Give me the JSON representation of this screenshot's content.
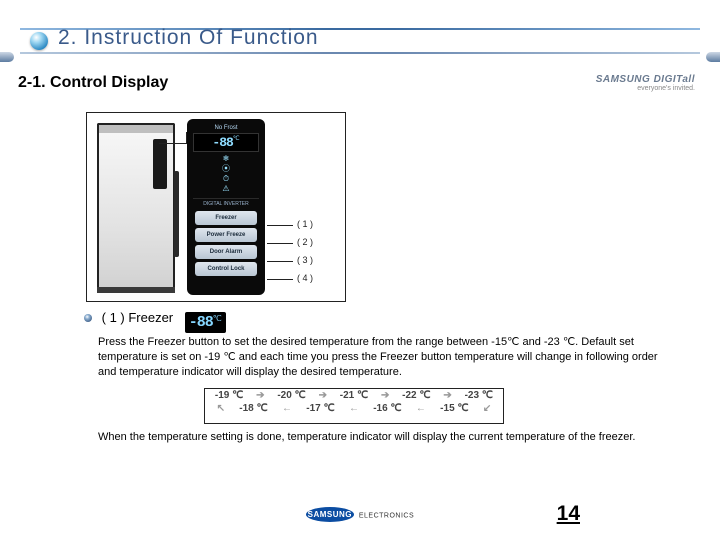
{
  "header": {
    "title": "2. Instruction Of Function"
  },
  "subheader": "2-1. Control Display",
  "brand": {
    "line1": "SAMSUNG DIGITall",
    "line2": "everyone's invited."
  },
  "panel": {
    "topLabel": "No Frost",
    "tempDigits": "-88",
    "tempUnit": "℃",
    "brand": "DIGITAL INVERTER",
    "buttons": [
      "Freezer",
      "Power Freeze",
      "Door Alarm",
      "Control Lock"
    ],
    "buttonMarks": [
      "( 1 )",
      "( 2 )",
      "( 3 )",
      "( 4 )"
    ]
  },
  "section": {
    "label": "( 1 ) Freezer",
    "inlineTempDigits": "-88",
    "inlineTempUnit": "℃",
    "para": "Press the Freezer button to set the desired temperature from the range between -15℃ and -23 ℃. Default set temperature is set on -19 ℃ and each time you press the Freezer button temperature will change in following order and temperature indicator will display the desired temperature.",
    "seqTop": [
      "-19 ℃",
      "-20 ℃",
      "-21 ℃",
      "-22 ℃",
      "-23 ℃"
    ],
    "seqBottom": [
      "-18 ℃",
      "-17 ℃",
      "-16 ℃",
      "-15 ℃"
    ],
    "note": "When the temperature setting is done, temperature indicator will display the current temperature of the freezer."
  },
  "footer": {
    "brand": "SAMSUNG",
    "sub": "ELECTRONICS"
  },
  "pageNo": "14"
}
